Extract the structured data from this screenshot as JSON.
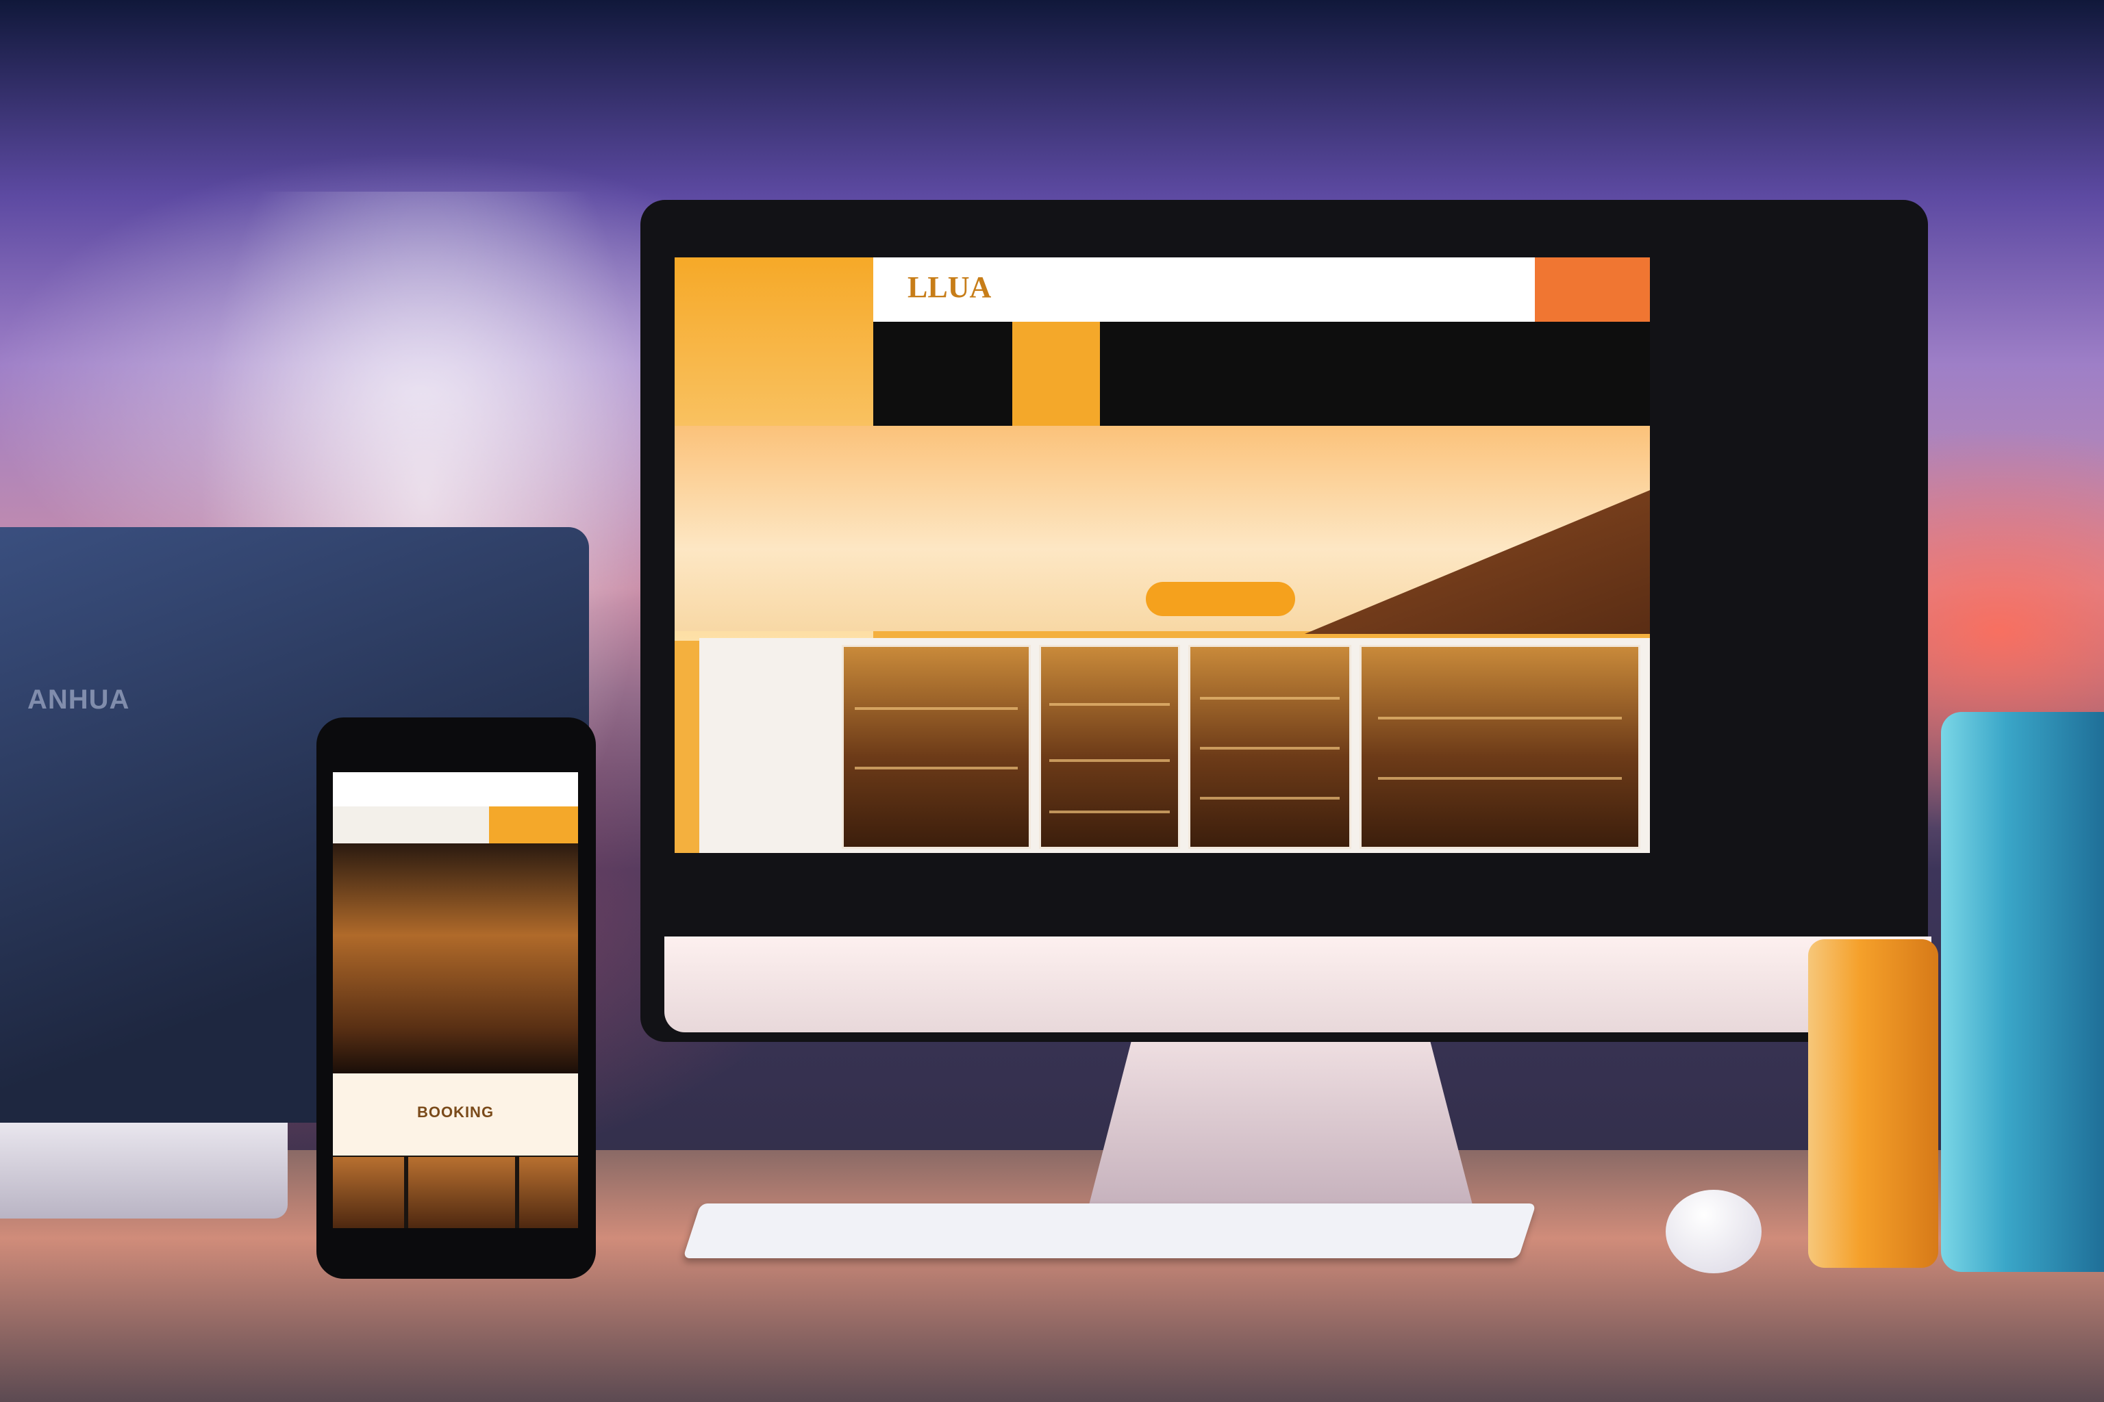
{
  "website": {
    "logo_text": "LLUA",
    "header_cta": "",
    "hero_title": "",
    "hero_button": ""
  },
  "laptop": {
    "logo_text": "ANHUA"
  },
  "phone": {
    "section_label": "BOOKING"
  },
  "colors": {
    "accent_orange": "#f4a82a",
    "cta_orange": "#f07632",
    "nav_black": "#0e0e0e",
    "wood_brown": "#6d3b18",
    "cylinder_blue": "#3aa6c8"
  }
}
